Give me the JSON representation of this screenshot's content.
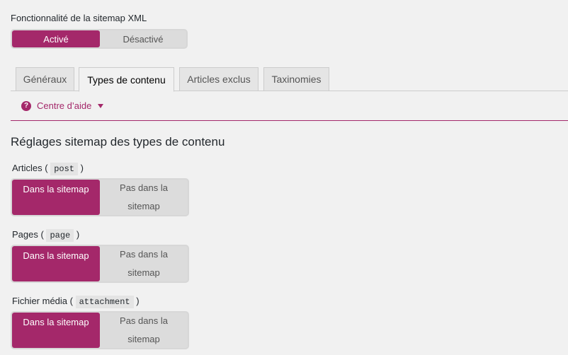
{
  "feature": {
    "label": "Fonctionnalité de la sitemap XML",
    "on": "Activé",
    "off": "Désactivé"
  },
  "tabs": [
    {
      "label": "Généraux"
    },
    {
      "label": "Types de contenu"
    },
    {
      "label": "Articles exclus"
    },
    {
      "label": "Taxinomies"
    }
  ],
  "help": {
    "label": "Centre d’aide",
    "icon": "?"
  },
  "section": {
    "title": "Réglages sitemap des types de contenu"
  },
  "post_types": [
    {
      "label": "Articles",
      "slug": "post",
      "in": "Dans la sitemap",
      "out_l1": "Pas dans la",
      "out_l2": "sitemap"
    },
    {
      "label": "Pages",
      "slug": "page",
      "in": "Dans la sitemap",
      "out_l1": "Pas dans la",
      "out_l2": "sitemap"
    },
    {
      "label": "Fichier média",
      "slug": "attachment",
      "in": "Dans la sitemap",
      "out_l1": "Pas dans la",
      "out_l2": "sitemap"
    }
  ],
  "colors": {
    "accent": "#a4286a",
    "background": "#f1f1f1"
  }
}
